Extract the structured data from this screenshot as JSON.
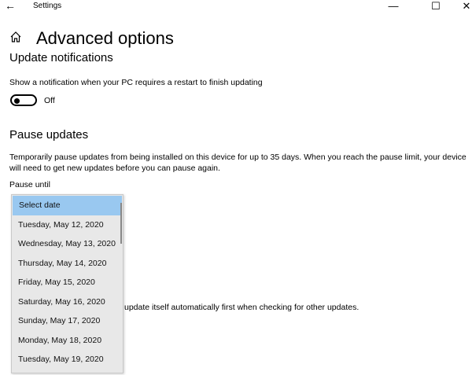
{
  "window": {
    "title": "Settings",
    "back": "←",
    "minimize": "—",
    "maximize": "☐",
    "close": "✕"
  },
  "page": {
    "title": "Advanced options",
    "home_icon": "home-icon"
  },
  "notifications": {
    "heading": "Update notifications",
    "description": "Show a notification when your PC requires a restart to finish updating",
    "toggle_state": "Off"
  },
  "pause": {
    "heading": "Pause updates",
    "description": "Temporarily pause updates from being installed on this device for up to 35 days. When you reach the pause limit, your device will need to get new updates before you can pause again.",
    "label": "Pause until",
    "options": [
      "Select date",
      "Tuesday, May 12, 2020",
      "Wednesday, May 13, 2020",
      "Thursday, May 14, 2020",
      "Friday, May 15, 2020",
      "Saturday, May 16, 2020",
      "Sunday, May 17, 2020",
      "Monday, May 18, 2020",
      "Tuesday, May 19, 2020"
    ]
  },
  "partial_text": "update itself automatically first when checking for other updates.",
  "colors": {
    "selected": "#99c8f0"
  }
}
